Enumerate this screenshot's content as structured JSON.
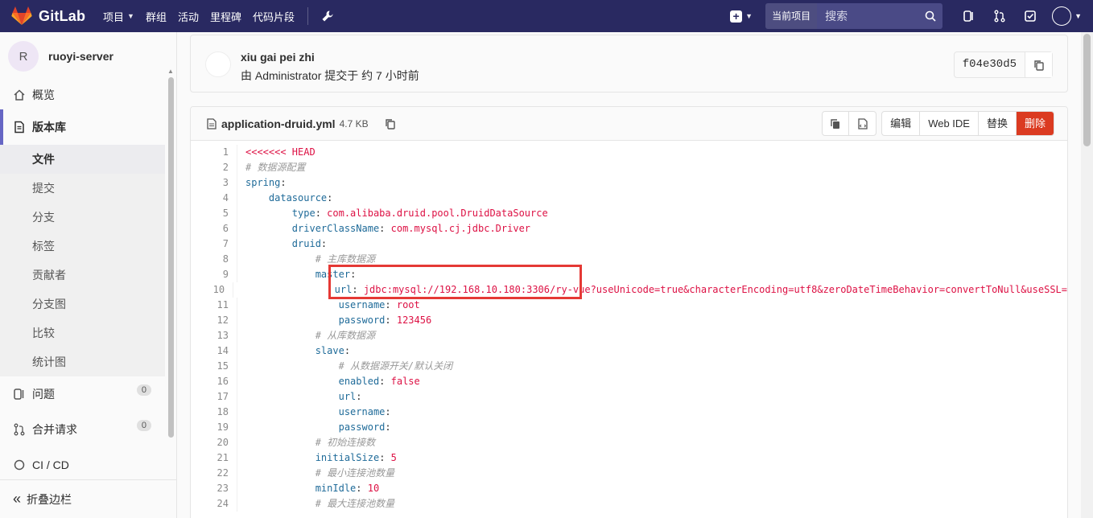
{
  "nav": {
    "brand": "GitLab",
    "items": [
      {
        "label": "项目",
        "caret": true
      },
      {
        "label": "群组",
        "caret": false
      },
      {
        "label": "活动",
        "caret": false
      },
      {
        "label": "里程碑",
        "caret": false
      },
      {
        "label": "代码片段",
        "caret": false
      }
    ],
    "scope_label": "当前项目",
    "search_placeholder": "搜索",
    "colors": {
      "bar": "#292961",
      "brand_orange": "#e24329"
    }
  },
  "sidebar": {
    "project_initial": "R",
    "project_name": "ruoyi-server",
    "overview": "概览",
    "repository": "版本库",
    "repo_items": [
      "文件",
      "提交",
      "分支",
      "标签",
      "贡献者",
      "分支图",
      "比较",
      "统计图"
    ],
    "issues": {
      "label": "问题",
      "count": "0"
    },
    "merge_requests": {
      "label": "合并请求",
      "count": "0"
    },
    "cicd": "CI / CD",
    "collapse": "折叠边栏"
  },
  "commit": {
    "title": "xiu gai pei zhi",
    "meta": "由 Administrator 提交于 约 7 小时前",
    "sha": "f04e30d5"
  },
  "file": {
    "name": "application-druid.yml",
    "size": "4.7 KB",
    "actions": {
      "edit": "编辑",
      "web_ide": "Web IDE",
      "replace": "替换",
      "delete": "删除"
    },
    "lines": [
      "<<<<<<< HEAD",
      "# 数据源配置",
      "spring:",
      "    datasource:",
      "        type: com.alibaba.druid.pool.DruidDataSource",
      "        driverClassName: com.mysql.cj.jdbc.Driver",
      "        druid:",
      "            # 主库数据源",
      "            master:",
      "                url: jdbc:mysql://192.168.10.180:3306/ry-vue?useUnicode=true&characterEncoding=utf8&zeroDateTimeBehavior=convertToNull&useSSL=",
      "                username: root",
      "                password: 123456",
      "            # 从库数据源",
      "            slave:",
      "                # 从数据源开关/默认关闭",
      "                enabled: false",
      "                url:",
      "                username:",
      "                password:",
      "            # 初始连接数",
      "            initialSize: 5",
      "            # 最小连接池数量",
      "            minIdle: 10",
      "            # 最大连接池数量"
    ]
  }
}
